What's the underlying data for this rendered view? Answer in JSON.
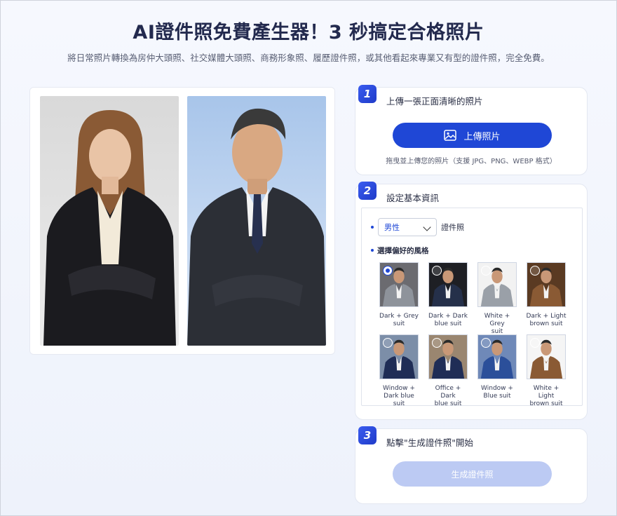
{
  "header": {
    "title": "AI證件照免費產生器！3 秒搞定合格照片",
    "subtitle": "將日常照片轉換為房仲大頭照、社交媒體大頭照、商務形象照、履歷證件照，或其他看起來專業又有型的證件照，完全免費。"
  },
  "colors": {
    "primary": "#1f47d6",
    "disabled": "#bccaf3"
  },
  "steps": {
    "upload": {
      "number": "1",
      "title": "上傳一張正面清晰的照片",
      "button_label": "上傳照片",
      "hint": "拖曳並上傳您的照片（支援 JPG、PNG、WEBP 格式）"
    },
    "settings": {
      "number": "2",
      "title": "設定基本資訊",
      "gender_value": "男性",
      "id_photo_label": "證件照",
      "style_label": "選擇偏好的風格",
      "styles": [
        {
          "line1": "Dark + Grey",
          "line2": "suit",
          "selected": true
        },
        {
          "line1": "Dark + Dark",
          "line2": "blue suit",
          "selected": false
        },
        {
          "line1": "White + Grey",
          "line2": "suit",
          "selected": false
        },
        {
          "line1": "Dark + Light",
          "line2": "brown suit",
          "selected": false
        },
        {
          "line1": "Window +",
          "line2": "Dark blue suit",
          "selected": false
        },
        {
          "line1": "Office + Dark",
          "line2": "blue suit",
          "selected": false
        },
        {
          "line1": "Window +",
          "line2": "Blue suit",
          "selected": false
        },
        {
          "line1": "White + Light",
          "line2": "brown suit",
          "selected": false
        }
      ]
    },
    "generate": {
      "number": "3",
      "title": "點擊\"生成證件照\"開始",
      "button_label": "生成證件照"
    }
  }
}
